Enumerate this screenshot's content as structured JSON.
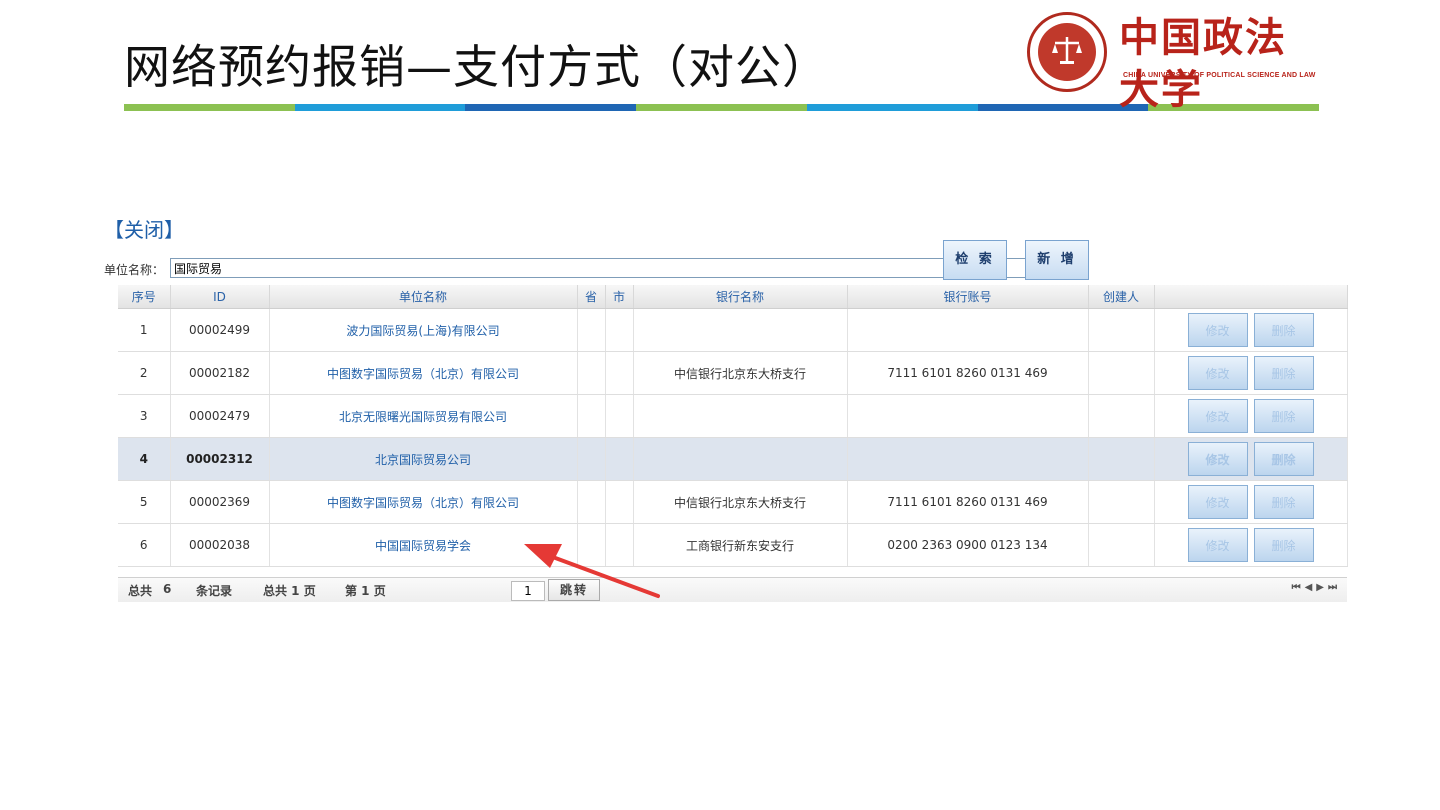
{
  "slide": {
    "title": "网络预约报销—支付方式（对公）",
    "color_bar": [
      "#8cc152",
      "#1f9dd9",
      "#1f66b4",
      "#8cc152",
      "#1f9dd9",
      "#1f66b4",
      "#8cc152"
    ]
  },
  "logo": {
    "cn": "中国政法大学",
    "en": "CHINA UNIVERSITY OF POLITICAL SCIENCE AND LAW"
  },
  "app": {
    "close_label": "【关闭】",
    "search": {
      "label": "单位名称：",
      "value": "国际贸易"
    },
    "buttons": {
      "search": "检 索",
      "add": "新 增"
    },
    "table": {
      "headers": [
        "序号",
        "ID",
        "单位名称",
        "省",
        "市",
        "银行名称",
        "银行账号",
        "创建人",
        ""
      ],
      "rows": [
        {
          "no": "1",
          "id": "00002499",
          "name": "波力国际贸易(上海)有限公司",
          "province": "",
          "city": "",
          "bank": "",
          "account": "",
          "creator": ""
        },
        {
          "no": "2",
          "id": "00002182",
          "name": "中图数字国际贸易（北京）有限公司",
          "province": "",
          "city": "",
          "bank": "中信银行北京东大桥支行",
          "account": "7111 6101 8260 0131 469",
          "creator": ""
        },
        {
          "no": "3",
          "id": "00002479",
          "name": "北京无限曙光国际贸易有限公司",
          "province": "",
          "city": "",
          "bank": "",
          "account": "",
          "creator": ""
        },
        {
          "no": "4",
          "id": "00002312",
          "name": "北京国际贸易公司",
          "province": "",
          "city": "",
          "bank": "",
          "account": "",
          "creator": ""
        },
        {
          "no": "5",
          "id": "00002369",
          "name": "中图数字国际贸易（北京）有限公司",
          "province": "",
          "city": "",
          "bank": "中信银行北京东大桥支行",
          "account": "7111 6101 8260 0131 469",
          "creator": ""
        },
        {
          "no": "6",
          "id": "00002038",
          "name": "中国国际贸易学会",
          "province": "",
          "city": "",
          "bank": "工商银行新东安支行",
          "account": "0200 2363 0900 0123 134",
          "creator": ""
        }
      ],
      "row_actions": {
        "edit": "修改",
        "delete": "删除"
      }
    },
    "pager": {
      "total_prefix": "总共",
      "total_records": "6",
      "records_suffix": "条记录",
      "total_pages": "总共  1 页",
      "current_page": "第  1 页",
      "page_input": "1",
      "jump": "跳转",
      "nav": [
        "⏮",
        "◀",
        "▶",
        "⏭"
      ]
    },
    "highlight_color": "#dde4ee",
    "arrow_color": "#e53935"
  }
}
